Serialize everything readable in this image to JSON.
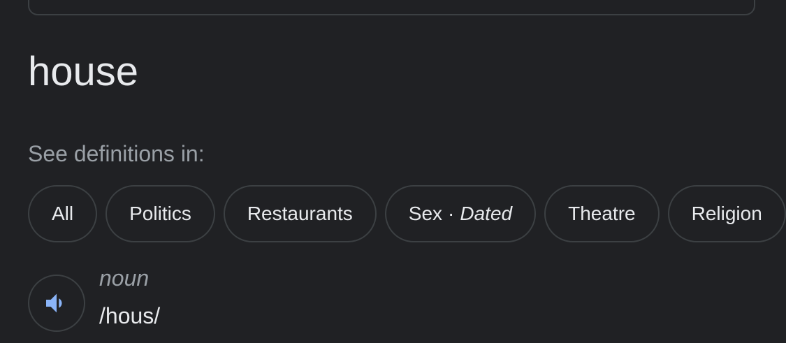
{
  "word": "house",
  "see_definitions_label": "See definitions in:",
  "chips": [
    {
      "label": "All"
    },
    {
      "label": "Politics"
    },
    {
      "label": "Restaurants"
    },
    {
      "label": "Sex",
      "separator": "·",
      "qualifier": "Dated"
    },
    {
      "label": "Theatre"
    },
    {
      "label": "Religion"
    }
  ],
  "entry": {
    "part_of_speech": "noun",
    "pronunciation": "/hous/",
    "speaker_icon": "speaker-icon"
  },
  "colors": {
    "background": "#202124",
    "border": "#3c4043",
    "text": "#e8eaed",
    "muted": "#9aa0a6",
    "accent": "#8ab4f8"
  }
}
